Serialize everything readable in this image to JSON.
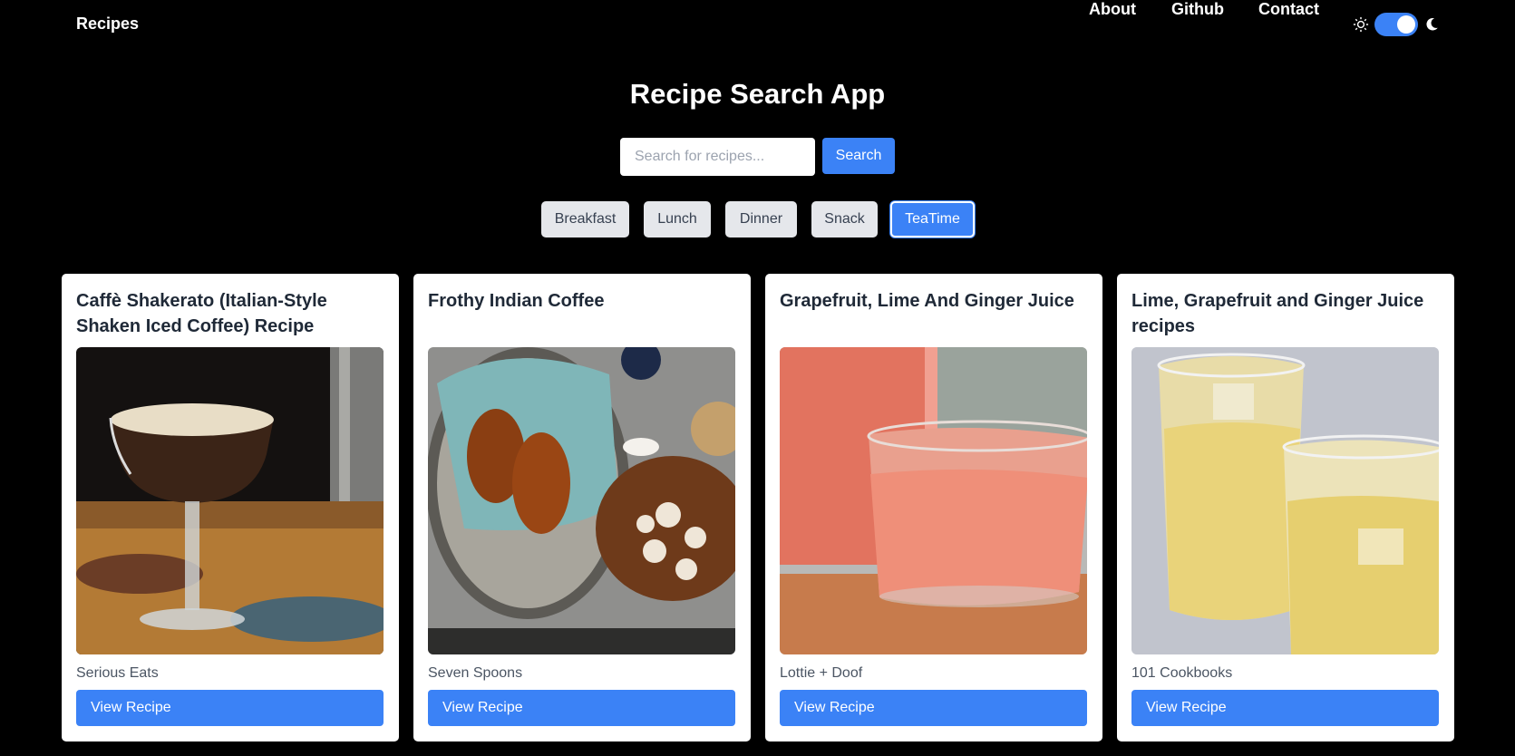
{
  "nav": {
    "brand": "Recipes",
    "links": [
      "About",
      "Github",
      "Contact"
    ],
    "theme_toggle_on": true
  },
  "hero": {
    "title": "Recipe Search App",
    "search_placeholder": "Search for recipes...",
    "search_value": "",
    "search_button": "Search"
  },
  "categories": {
    "items": [
      "Breakfast",
      "Lunch",
      "Dinner",
      "Snack",
      "TeaTime"
    ],
    "active": "TeaTime"
  },
  "recipes": [
    {
      "title": "Caffè Shakerato (Italian-Style Shaken Iced Coffee) Recipe",
      "source": "Serious Eats",
      "button": "View Recipe",
      "image_icon": "coffee-cocktail-photo"
    },
    {
      "title": "Frothy Indian Coffee",
      "source": "Seven Spoons",
      "button": "View Recipe",
      "image_icon": "croissants-coffee-photo"
    },
    {
      "title": "Grapefruit, Lime And Ginger Juice",
      "source": "Lottie + Doof",
      "button": "View Recipe",
      "image_icon": "pink-juice-photo"
    },
    {
      "title": "Lime, Grapefruit and Ginger Juice recipes",
      "source": "101 Cookbooks",
      "button": "View Recipe",
      "image_icon": "yellow-juice-photo"
    }
  ],
  "colors": {
    "accent": "#3b82f6",
    "background": "#000000",
    "card": "#ffffff"
  }
}
